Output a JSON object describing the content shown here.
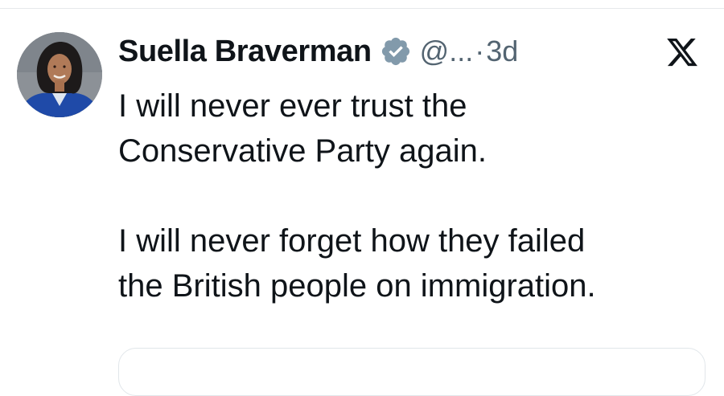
{
  "tweet": {
    "author": {
      "display_name": "Suella Braverman",
      "handle": "@...",
      "verified": true
    },
    "separator": "·",
    "timestamp": "3d",
    "paragraphs": [
      "I will never ever trust the\nConservative Party again.",
      "I will never forget how they failed\nthe British people on immigration."
    ]
  },
  "icons": {
    "verified": "verified-badge-icon",
    "platform": "x-logo-icon"
  },
  "colors": {
    "text_primary": "#0f1419",
    "text_secondary": "#536471",
    "badge": "#829aab"
  }
}
